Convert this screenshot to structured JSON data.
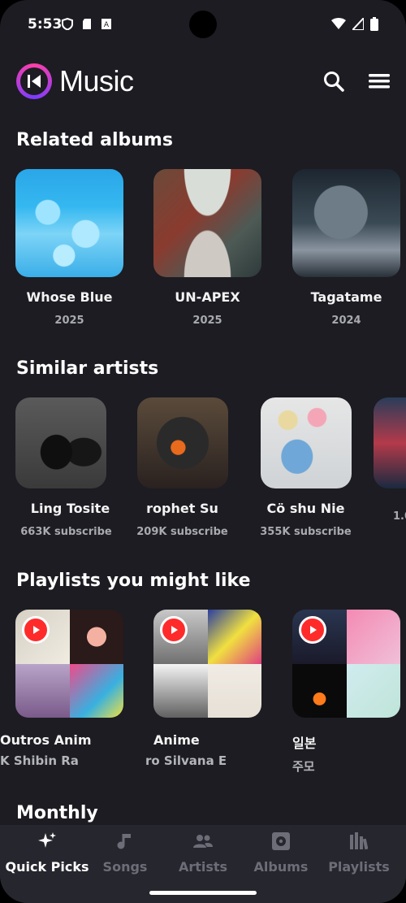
{
  "status_bar": {
    "time": "5:53"
  },
  "app": {
    "title": "Music"
  },
  "header_icons": [
    "search-icon",
    "menu-icon"
  ],
  "sections": {
    "related_albums": {
      "title": "Related albums",
      "items": [
        {
          "title": "Whose Blue",
          "year": "2025"
        },
        {
          "title": "UN-APEX",
          "year": "2025"
        },
        {
          "title": "Tagatame",
          "year": "2024"
        }
      ]
    },
    "similar_artists": {
      "title": "Similar artists",
      "items": [
        {
          "name": "Ling Tosite",
          "subs": "663K subscribe"
        },
        {
          "name": "rophet     Su",
          "subs": "209K subscribe"
        },
        {
          "name": "Cö shu Nie",
          "subs": "355K subscribe"
        },
        {
          "name": "",
          "subs": "1.0"
        }
      ]
    },
    "playlists": {
      "title": "Playlists you might like",
      "items": [
        {
          "title": "Outros       Anim",
          "sub": "K     Shibin Ra"
        },
        {
          "title": "Anime",
          "sub": "ro     Silvana E"
        },
        {
          "title": "일본",
          "sub": "주모"
        }
      ]
    },
    "monthly": {
      "title": "Monthly"
    }
  },
  "bottom_nav": [
    {
      "label": "Quick Picks",
      "icon": "sparkle-icon",
      "active": true
    },
    {
      "label": "Songs",
      "icon": "music-note-icon",
      "active": false
    },
    {
      "label": "Artists",
      "icon": "people-icon",
      "active": false
    },
    {
      "label": "Albums",
      "icon": "album-icon",
      "active": false
    },
    {
      "label": "Playlists",
      "icon": "library-icon",
      "active": false
    }
  ],
  "colors": {
    "background": "#1c1c22",
    "nav_background": "#26262e",
    "accent": "#ff3fa8"
  }
}
